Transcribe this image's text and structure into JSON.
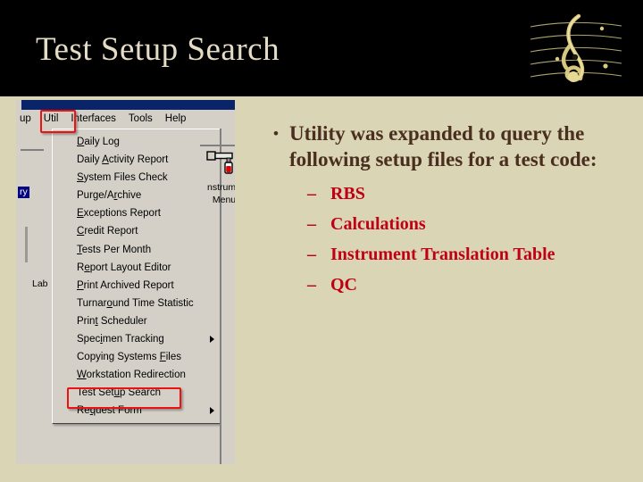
{
  "slide": {
    "title": "Test Setup Search",
    "title_color": "#e4dcc4",
    "band_color": "#000000",
    "background_color": "#dad5b4",
    "logo_icon": "treble-clef-logo"
  },
  "content": {
    "bullet_marker": "•",
    "main_bullet": "Utility  was expanded to query the following setup files for a test code:",
    "main_bullet_color": "#4a2e20",
    "sub_marker": "–",
    "sub_bullet_color": "#c00014",
    "sub_bullets": [
      "RBS",
      "Calculations",
      "Instrument Translation Table",
      "QC"
    ]
  },
  "app": {
    "titlebar_color": "#0a246a",
    "chrome_color": "#d4d0c8",
    "highlight_color": "#ee1111",
    "menubar": [
      {
        "label": "up",
        "partial": true
      },
      {
        "label": "Util",
        "highlighted": true
      },
      {
        "label": "Interfaces"
      },
      {
        "label": "Tools"
      },
      {
        "label": "Help"
      }
    ],
    "menu": {
      "owner": "Util",
      "items": [
        {
          "pre": "",
          "acc": "D",
          "post": "aily Log",
          "submenu": false
        },
        {
          "pre": "Daily ",
          "acc": "A",
          "post": "ctivity Report",
          "submenu": false
        },
        {
          "pre": "",
          "acc": "S",
          "post": "ystem Files Check",
          "submenu": false
        },
        {
          "pre": "Purge/A",
          "acc": "r",
          "post": "chive",
          "submenu": false
        },
        {
          "pre": "",
          "acc": "E",
          "post": "xceptions Report",
          "submenu": false
        },
        {
          "pre": "",
          "acc": "C",
          "post": "redit Report",
          "submenu": false
        },
        {
          "pre": "",
          "acc": "T",
          "post": "ests Per Month",
          "submenu": false
        },
        {
          "pre": "R",
          "acc": "e",
          "post": "port Layout Editor",
          "submenu": false
        },
        {
          "pre": "",
          "acc": "P",
          "post": "rint Archived Report",
          "submenu": false
        },
        {
          "pre": "Turnar",
          "acc": "o",
          "post": "und Time Statistic",
          "submenu": false
        },
        {
          "pre": "Prin",
          "acc": "t",
          "post": " Scheduler",
          "submenu": false
        },
        {
          "pre": "Spec",
          "acc": "i",
          "post": "men Tracking",
          "submenu": true
        },
        {
          "pre": "Copying Systems ",
          "acc": "F",
          "post": "iles",
          "submenu": false
        },
        {
          "pre": "",
          "acc": "W",
          "post": "orkstation Redirection",
          "submenu": false
        },
        {
          "pre": "Test Set",
          "acc": "u",
          "post": "p Search",
          "submenu": false,
          "highlighted": true
        },
        {
          "pre": "Re",
          "acc": "q",
          "post": "uest Form",
          "submenu": true
        }
      ]
    },
    "left_column": {
      "selected_item": "ry",
      "label_lab": "Lab"
    },
    "right_panel": {
      "icon": "instrument-pipette-icon",
      "label_line1": "nstrume",
      "label_line2": "Menu"
    }
  }
}
